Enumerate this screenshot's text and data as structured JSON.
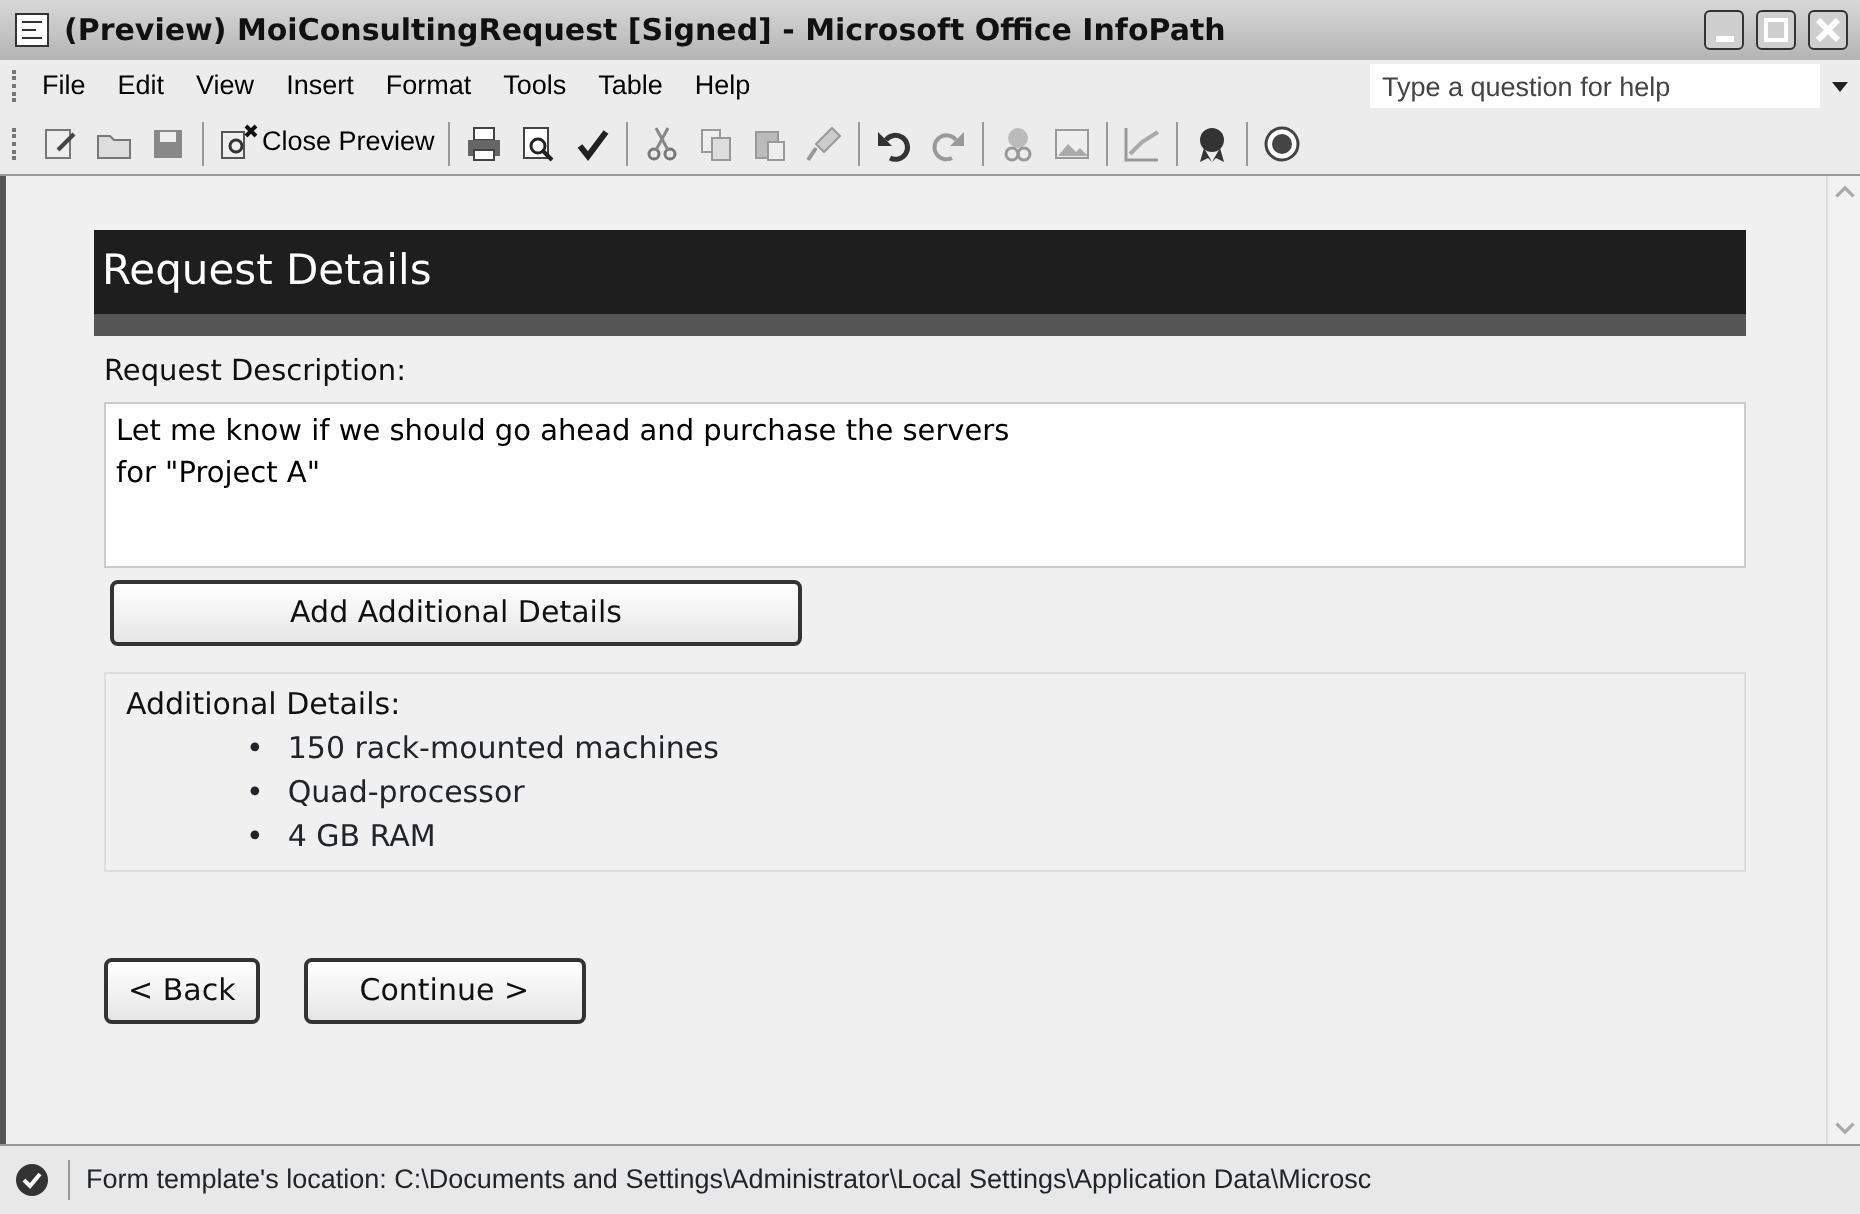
{
  "window": {
    "title": "(Preview) MoiConsultingRequest [Signed] - Microsoft Office InfoPath"
  },
  "menu": [
    {
      "label": "File"
    },
    {
      "label": "Edit"
    },
    {
      "label": "View"
    },
    {
      "label": "Insert"
    },
    {
      "label": "Format"
    },
    {
      "label": "Tools"
    },
    {
      "label": "Table"
    },
    {
      "label": "Help"
    }
  ],
  "help_box": {
    "placeholder": "Type a question for help"
  },
  "toolbar": {
    "close_preview": {
      "label": "Close Preview"
    }
  },
  "form": {
    "heading": "Request Details",
    "description_label": "Request Description:",
    "description_value": "Let me know if we should go ahead and purchase the servers\nfor \"Project A\"",
    "add_button": "Add Additional Details",
    "details_label": "Additional Details:",
    "details": [
      {
        "bullet": "•",
        "text": "150 rack-mounted machines"
      },
      {
        "bullet": "•",
        "text": "Quad-processor"
      },
      {
        "bullet": "•",
        "text": "4 GB RAM"
      }
    ],
    "buttons": [
      "< Back",
      "Continue >"
    ]
  },
  "status_bar": {
    "text": "Form template's location: C:\\Documents and Settings\\Administrator\\Local Settings\\Application Data\\Microsc"
  }
}
